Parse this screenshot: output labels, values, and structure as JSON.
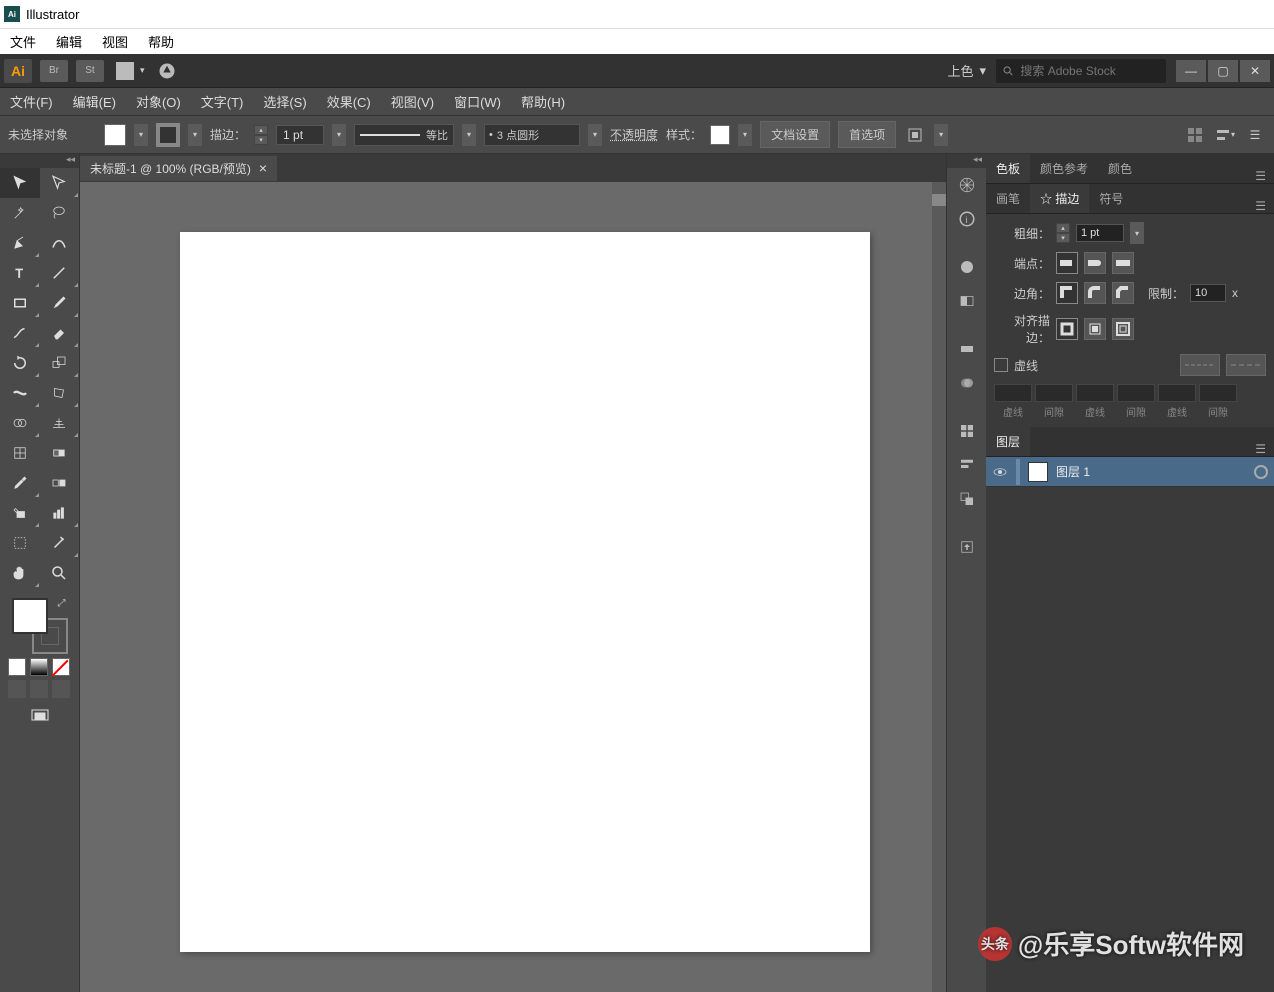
{
  "titlebar": {
    "appName": "Illustrator"
  },
  "osMenu": [
    "文件",
    "编辑",
    "视图",
    "帮助"
  ],
  "appHeader": {
    "logo": "Ai",
    "bridge": "Br",
    "stock": "St",
    "colorMode": "上色",
    "searchPlaceholder": "搜索 Adobe Stock"
  },
  "appMenu": [
    "文件(F)",
    "编辑(E)",
    "对象(O)",
    "文字(T)",
    "选择(S)",
    "效果(C)",
    "视图(V)",
    "窗口(W)",
    "帮助(H)"
  ],
  "controlBar": {
    "noSelection": "未选择对象",
    "strokeLabel": "描边：",
    "strokeWeight": "1 pt",
    "strokeStyleLabel": "等比",
    "brush": "3 点圆形",
    "opacityLabel": "不透明度",
    "styleLabel": "样式：",
    "docSetup": "文档设置",
    "preferences": "首选项"
  },
  "docTab": {
    "title": "未标题-1 @ 100% (RGB/预览)"
  },
  "panels": {
    "colorTabs": [
      "色板",
      "颜色参考",
      "颜色"
    ],
    "strokeTabs": [
      "画笔",
      "☆ 描边",
      "符号"
    ],
    "layerTab": "图层",
    "stroke": {
      "weightLabel": "粗细：",
      "weight": "1 pt",
      "capLabel": "端点：",
      "cornerLabel": "边角：",
      "limitLabel": "限制：",
      "limit": "10",
      "limitUnit": "x",
      "alignLabel": "对齐描边：",
      "dashedLabel": "虚线",
      "dashLabels": [
        "虚线",
        "间隙",
        "虚线",
        "间隙",
        "虚线",
        "间隙"
      ]
    },
    "layers": [
      {
        "name": "图层 1"
      }
    ]
  },
  "watermark": {
    "prefix": "头条",
    "text": "@乐享Softw软件网"
  }
}
